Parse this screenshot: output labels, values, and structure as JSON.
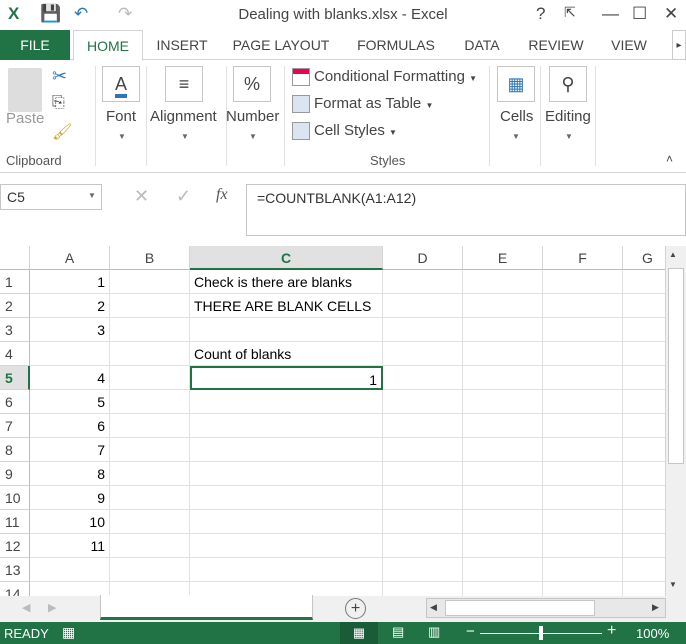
{
  "titlebar": {
    "title": "Dealing with blanks.xlsx - Excel",
    "help": "?",
    "minimize": "—",
    "maximize": "☐",
    "close": "✕"
  },
  "tabs": [
    "FILE",
    "HOME",
    "INSERT",
    "PAGE LAYOUT",
    "FORMULAS",
    "DATA",
    "REVIEW",
    "VIEW"
  ],
  "ribbon": {
    "paste": "Paste",
    "clipboard": "Clipboard",
    "font": "Font",
    "alignment": "Alignment",
    "number": "Number",
    "conditional_formatting": "Conditional Formatting",
    "format_as_table": "Format as Table",
    "cell_styles": "Cell Styles",
    "styles": "Styles",
    "cells": "Cells",
    "editing": "Editing"
  },
  "formula_bar": {
    "name_box": "C5",
    "formula": "=COUNTBLANK(A1:A12)",
    "fx": "fx"
  },
  "grid": {
    "columns": [
      "A",
      "B",
      "C",
      "D",
      "E",
      "F",
      "G"
    ],
    "rows": [
      "1",
      "2",
      "3",
      "4",
      "5",
      "6",
      "7",
      "8",
      "9",
      "10",
      "11",
      "12",
      "13",
      "14"
    ],
    "active_cell": "C5",
    "cells": {
      "A1": "1",
      "A2": "2",
      "A3": "3",
      "A5": "4",
      "A6": "5",
      "A7": "6",
      "A8": "7",
      "A9": "8",
      "A10": "9",
      "A11": "10",
      "A12": "11",
      "C1": "Check is there are blanks",
      "C2": "THERE ARE BLANK CELLS",
      "C4": "Count of blanks",
      "C5": "1"
    }
  },
  "sheet_tabs": {
    "sheet1": ""
  },
  "status": {
    "ready": "READY",
    "zoom": "100%"
  },
  "colors": {
    "excel_green": "#217346"
  }
}
